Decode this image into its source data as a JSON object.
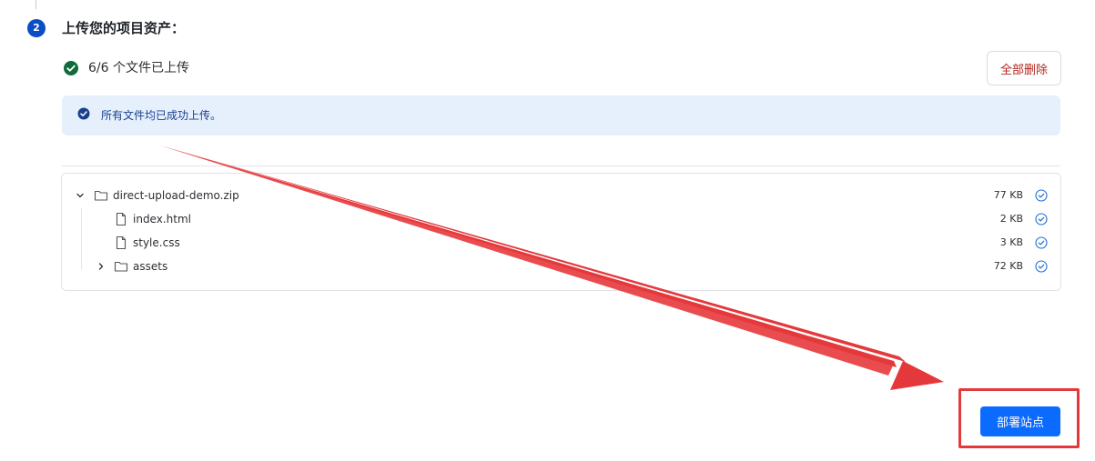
{
  "step": {
    "number": "2",
    "title": "上传您的项目资产："
  },
  "upload_status": {
    "text": "6/6 个文件已上传",
    "icon": "check-circle-icon",
    "color": "#0f6b3a"
  },
  "delete_all": {
    "label": "全部删除",
    "color": "#b3261e"
  },
  "alert": {
    "icon": "check-circle-icon",
    "text": "所有文件均已成功上传。",
    "background": "#e6f0fd"
  },
  "file_tree": {
    "root": {
      "name": "direct-upload-demo.zip",
      "size": "77 KB",
      "expanded": true,
      "icon": "folder-icon"
    },
    "children": [
      {
        "name": "index.html",
        "size": "2 KB",
        "icon": "file-icon"
      },
      {
        "name": "style.css",
        "size": "3 KB",
        "icon": "file-icon"
      },
      {
        "name": "assets",
        "size": "72 KB",
        "icon": "folder-icon",
        "expanded": false
      }
    ]
  },
  "deploy": {
    "label": "部署站点",
    "color": "#0b6bff"
  },
  "annotation": {
    "arrow_color": "#e5383b",
    "highlight_color": "#e5383b"
  }
}
